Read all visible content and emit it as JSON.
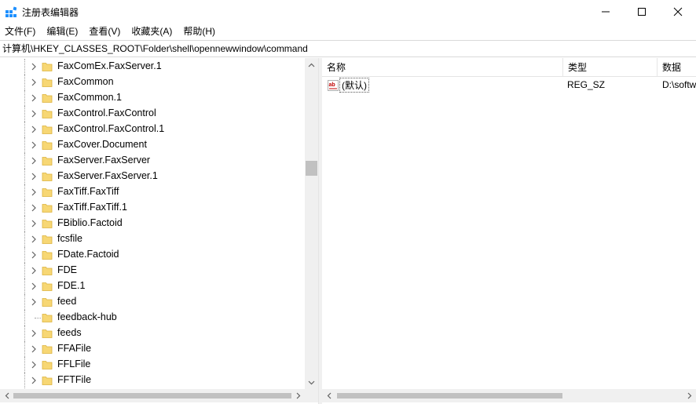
{
  "window": {
    "title": "注册表编辑器",
    "icon": "regedit-icon",
    "controls": {
      "minimize": "minimize-icon",
      "maximize": "maximize-icon",
      "close": "close-icon"
    }
  },
  "menu": [
    "文件(F)",
    "编辑(E)",
    "查看(V)",
    "收藏夹(A)",
    "帮助(H)"
  ],
  "address": "计算机\\HKEY_CLASSES_ROOT\\Folder\\shell\\opennewwindow\\command",
  "tree": {
    "items": [
      {
        "label": "FaxComEx.FaxServer.1",
        "expandable": true
      },
      {
        "label": "FaxCommon",
        "expandable": true
      },
      {
        "label": "FaxCommon.1",
        "expandable": true
      },
      {
        "label": "FaxControl.FaxControl",
        "expandable": true
      },
      {
        "label": "FaxControl.FaxControl.1",
        "expandable": true
      },
      {
        "label": "FaxCover.Document",
        "expandable": true
      },
      {
        "label": "FaxServer.FaxServer",
        "expandable": true
      },
      {
        "label": "FaxServer.FaxServer.1",
        "expandable": true
      },
      {
        "label": "FaxTiff.FaxTiff",
        "expandable": true
      },
      {
        "label": "FaxTiff.FaxTiff.1",
        "expandable": true
      },
      {
        "label": "FBiblio.Factoid",
        "expandable": true
      },
      {
        "label": "fcsfile",
        "expandable": true
      },
      {
        "label": "FDate.Factoid",
        "expandable": true
      },
      {
        "label": "FDE",
        "expandable": true
      },
      {
        "label": "FDE.1",
        "expandable": true
      },
      {
        "label": "feed",
        "expandable": true
      },
      {
        "label": "feedback-hub",
        "expandable": false
      },
      {
        "label": "feeds",
        "expandable": true
      },
      {
        "label": "FFAFile",
        "expandable": true
      },
      {
        "label": "FFLFile",
        "expandable": true
      },
      {
        "label": "FFTFile",
        "expandable": true
      }
    ]
  },
  "list": {
    "columns": {
      "name": "名称",
      "type": "类型",
      "data": "数据"
    },
    "rows": [
      {
        "name": "(默认)",
        "type": "REG_SZ",
        "data": "D:\\softw",
        "icon": "string-value-icon"
      }
    ]
  },
  "colors": {
    "folder": "#f7d774",
    "folder_edge": "#dcb33d",
    "accent": "#0078d7",
    "scroll_track": "#f0f0f0",
    "scroll_thumb": "#c1c1c1"
  }
}
